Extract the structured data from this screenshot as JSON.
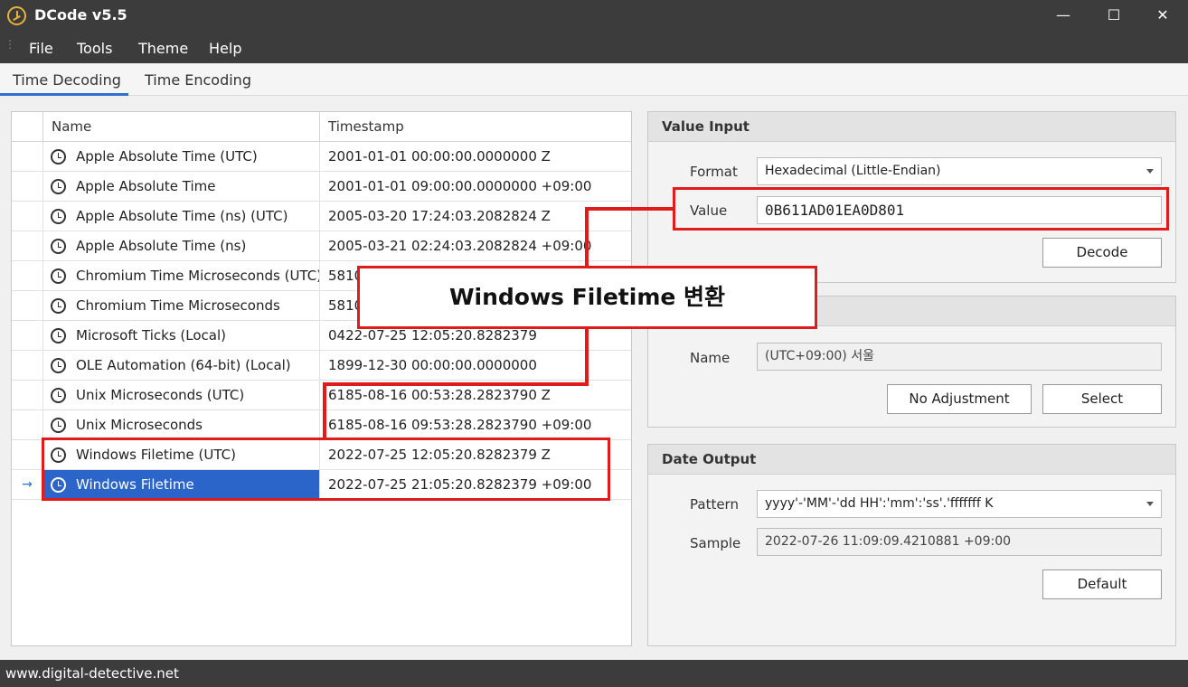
{
  "window": {
    "title": "DCode v5.5",
    "minimize_glyph": "—",
    "maximize_glyph": "☐",
    "close_glyph": "✕"
  },
  "menu": {
    "items": [
      "File",
      "Tools",
      "Theme",
      "Help"
    ]
  },
  "tabs": [
    {
      "label": "Time Decoding",
      "active": true
    },
    {
      "label": "Time Encoding",
      "active": false
    }
  ],
  "table": {
    "columns": {
      "name": "Name",
      "timestamp": "Timestamp"
    },
    "selected_marker": "→",
    "rows": [
      {
        "name": "Apple Absolute Time (UTC)",
        "timestamp": "2001-01-01 00:00:00.0000000 Z"
      },
      {
        "name": "Apple Absolute Time",
        "timestamp": "2001-01-01 09:00:00.0000000 +09:00"
      },
      {
        "name": "Apple Absolute Time (ns) (UTC)",
        "timestamp": "2005-03-20 17:24:03.2082824 Z"
      },
      {
        "name": "Apple Absolute Time (ns)",
        "timestamp": "2005-03-21 02:24:03.2082824 +09:00"
      },
      {
        "name": "Chromium Time Microseconds (UTC)",
        "timestamp": "5810"
      },
      {
        "name": "Chromium Time Microseconds",
        "timestamp": "5810"
      },
      {
        "name": "Microsoft Ticks (Local)",
        "timestamp": "0422-07-25 12:05:20.8282379"
      },
      {
        "name": "OLE Automation (64-bit) (Local)",
        "timestamp": "1899-12-30 00:00:00.0000000"
      },
      {
        "name": "Unix Microseconds (UTC)",
        "timestamp": "6185-08-16 00:53:28.2823790 Z"
      },
      {
        "name": "Unix Microseconds",
        "timestamp": "6185-08-16 09:53:28.2823790 +09:00"
      },
      {
        "name": "Windows Filetime (UTC)",
        "timestamp": "2022-07-25 12:05:20.8282379 Z"
      },
      {
        "name": "Windows Filetime",
        "timestamp": "2022-07-25 21:05:20.8282379 +09:00"
      }
    ]
  },
  "value_input": {
    "title": "Value Input",
    "format_label": "Format",
    "format_value": "Hexadecimal (Little-Endian)",
    "value_label": "Value",
    "value": "0B611AD01EA0D801",
    "decode_label": "Decode"
  },
  "adjustment": {
    "name_label": "Name",
    "name_value": "(UTC+09:00) 서울",
    "no_adjustment_label": "No Adjustment",
    "select_label": "Select"
  },
  "date_output": {
    "title": "Date Output",
    "pattern_label": "Pattern",
    "pattern_value": "yyyy'-'MM'-'dd HH':'mm':'ss'.'fffffff K",
    "sample_label": "Sample",
    "sample_value": "2022-07-26 11:09:09.4210881 +09:00",
    "default_label": "Default"
  },
  "status": {
    "url": "www.digital-detective.net"
  },
  "annotation": {
    "callout": "Windows Filetime 변환"
  },
  "colors": {
    "accent": "#2b65c9",
    "annotation": "#e11a1a",
    "chrome": "#3c3c3c"
  }
}
